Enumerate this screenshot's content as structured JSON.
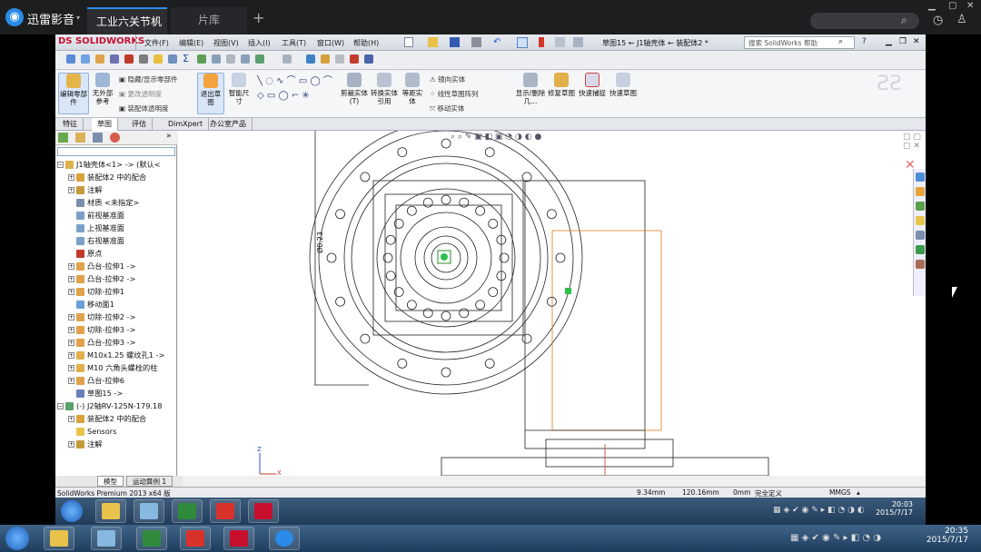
{
  "player": {
    "app_name": "迅雷影音",
    "tabs": [
      "工业六关节机",
      "片库"
    ],
    "close_glyph": "×",
    "add_tab_glyph": "+"
  },
  "solidworks": {
    "logo": "SOLIDWORKS",
    "menus": [
      "文件(F)",
      "编辑(E)",
      "视图(V)",
      "插入(I)",
      "工具(T)",
      "窗口(W)",
      "帮助(H)"
    ],
    "doc_title": "草图15 ← J1轴壳体 ← 装配体2 *",
    "search_placeholder": "搜索 SolidWorks 帮助",
    "ribbon": {
      "edit_part": "编辑零部件",
      "external_ref": "无外部参考",
      "hide_show": "隐藏/显示零部件",
      "change_transparency": "更改透明度",
      "assembly_transparency": "装配体透明度",
      "exit_sketch": "退出草图",
      "smart_dim": "智能尺寸",
      "trim": "剪裁实体(T)",
      "convert": "转换实体引用",
      "offset": "等距实体",
      "mirror": "镜向实体",
      "linear_pattern": "线性草图阵列",
      "move": "移动实体",
      "display_delete": "显示/删除几...",
      "repair": "修复草图",
      "snap": "快速捕捉",
      "rapid_sketch": "快速草图"
    },
    "cmgr_tabs": [
      "特征",
      "草图",
      "评估",
      "DimXpert",
      "办公室产品"
    ],
    "tree": [
      {
        "label": "J1轴壳体<1> -> (默认<",
        "level": 0,
        "exp": "−"
      },
      {
        "label": "装配体2 中的配合",
        "level": 1,
        "exp": "+"
      },
      {
        "label": "注解",
        "level": 1,
        "exp": "+"
      },
      {
        "label": "材质 <未指定>",
        "level": 1,
        "exp": ""
      },
      {
        "label": "前视基准面",
        "level": 1,
        "exp": ""
      },
      {
        "label": "上视基准面",
        "level": 1,
        "exp": ""
      },
      {
        "label": "右视基准面",
        "level": 1,
        "exp": ""
      },
      {
        "label": "原点",
        "level": 1,
        "exp": ""
      },
      {
        "label": "凸台-拉伸1 ->",
        "level": 1,
        "exp": "+"
      },
      {
        "label": "凸台-拉伸2 ->",
        "level": 1,
        "exp": "+"
      },
      {
        "label": "切除-拉伸1",
        "level": 1,
        "exp": "+"
      },
      {
        "label": "移动面1",
        "level": 1,
        "exp": ""
      },
      {
        "label": "切除-拉伸2 ->",
        "level": 1,
        "exp": "+"
      },
      {
        "label": "切除-拉伸3 ->",
        "level": 1,
        "exp": "+"
      },
      {
        "label": "凸台-拉伸3 ->",
        "level": 1,
        "exp": "+"
      },
      {
        "label": "M10x1.25 螺纹孔1 ->",
        "level": 1,
        "exp": "+"
      },
      {
        "label": "M10 六角头螺栓的柱",
        "level": 1,
        "exp": "+"
      },
      {
        "label": "凸台-拉伸6",
        "level": 1,
        "exp": "+"
      },
      {
        "label": "草图15 ->",
        "level": 1,
        "exp": ""
      },
      {
        "label": "(-) J2轴RV-125N-179.18",
        "level": 0,
        "exp": "−"
      },
      {
        "label": "装配体2 中的配合",
        "level": 1,
        "exp": "+"
      },
      {
        "label": "Sensors",
        "level": 1,
        "exp": ""
      },
      {
        "label": "注解",
        "level": 1,
        "exp": "+"
      }
    ],
    "bottom_tabs": [
      "模型",
      "运动算例 1"
    ],
    "dimension_label": "Ø0.23",
    "axis_labels": {
      "y": "Z",
      "x": "X"
    },
    "status": {
      "product": "SolidWorks Premium 2013 x64 版",
      "x": "9.34mm",
      "y": "120.16mm",
      "z": "0mm",
      "state": "完全定义",
      "units": "MMGS"
    }
  },
  "clock_inner": {
    "time": "20:03",
    "date": "2015/7/17"
  },
  "clock_outer": {
    "time": "20:35",
    "date": "2015/7/17"
  },
  "colors": {
    "sw_red": "#c8102e",
    "sketch_orange": "#e07b1a",
    "accent_blue": "#2a8be8"
  }
}
